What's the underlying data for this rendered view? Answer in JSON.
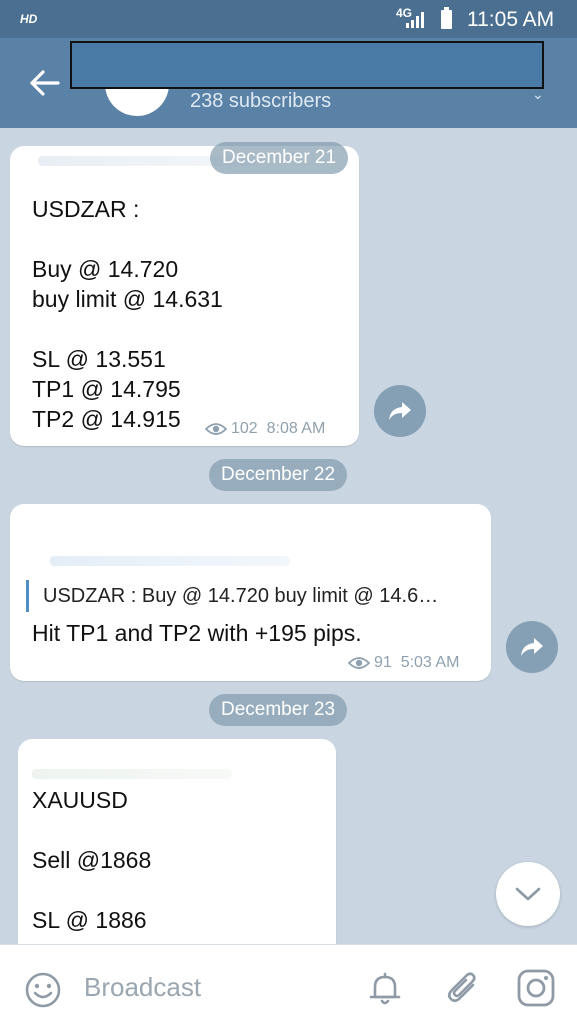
{
  "status_bar": {
    "hd": "HD",
    "network": "4G",
    "time": "11:05 AM"
  },
  "header": {
    "subscribers": "238 subscribers"
  },
  "messages": [
    {
      "date": "December 21",
      "lines": [
        "USDZAR :",
        "",
        "Buy @ 14.720",
        "buy limit @ 14.631",
        "",
        "SL @ 13.551",
        "TP1 @ 14.795",
        "TP2 @ 14.915"
      ],
      "views": "102",
      "time": "8:08 AM"
    },
    {
      "date": "December 22",
      "reply_preview": "USDZAR :  Buy @ 14.720 buy limit @ 14.6…",
      "text": "Hit TP1 and TP2 with +195 pips.",
      "views": "91",
      "time": "5:03 AM"
    },
    {
      "date": "December 23",
      "lines": [
        "XAUUSD",
        "",
        "Sell @1868",
        "",
        "SL @ 1886"
      ]
    }
  ],
  "input": {
    "placeholder": "Broadcast"
  },
  "icons": {
    "back": "arrow-left-icon",
    "share": "share-icon",
    "views": "eye-icon",
    "scroll_down": "chevron-down-icon",
    "emoji": "emoji-icon",
    "bell": "bell-icon",
    "attach": "paperclip-icon",
    "camera": "instagram-icon"
  },
  "colors": {
    "header": "#5a82a6",
    "status_bar": "#4a6f90",
    "chat_bg": "#c9d6e1",
    "reply_bar": "#4f8fc6"
  }
}
